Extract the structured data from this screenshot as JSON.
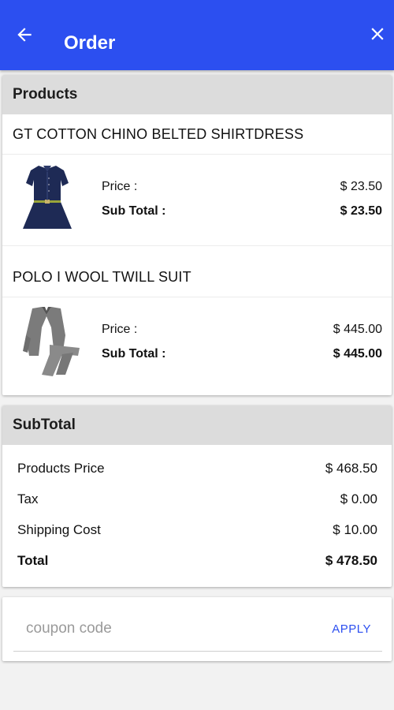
{
  "appbar": {
    "title": "Order",
    "back_icon": "arrow-left-icon",
    "close_icon": "close-icon",
    "color": "#2c4ff0"
  },
  "products": {
    "header": "Products",
    "items": [
      {
        "name": "GT COTTON CHINO BELTED SHIRTDRESS",
        "price_label": "Price :",
        "price": "$ 23.50",
        "subtotal_label": "Sub Total :",
        "subtotal": "$ 23.50",
        "image": "navy-dress-image"
      },
      {
        "name": "POLO I WOOL TWILL SUIT",
        "price_label": "Price :",
        "price": "$ 445.00",
        "subtotal_label": "Sub Total :",
        "subtotal": "$ 445.00",
        "image": "grey-suit-image"
      }
    ]
  },
  "subtotal": {
    "header": "SubTotal",
    "rows": [
      {
        "label": "Products Price",
        "value": "$ 468.50"
      },
      {
        "label": "Tax",
        "value": "$ 0.00"
      },
      {
        "label": "Shipping Cost",
        "value": "$ 10.00"
      },
      {
        "label": "Total",
        "value": "$ 478.50"
      }
    ]
  },
  "coupon": {
    "placeholder": "coupon code",
    "value": "",
    "apply_label": "APPLY"
  }
}
